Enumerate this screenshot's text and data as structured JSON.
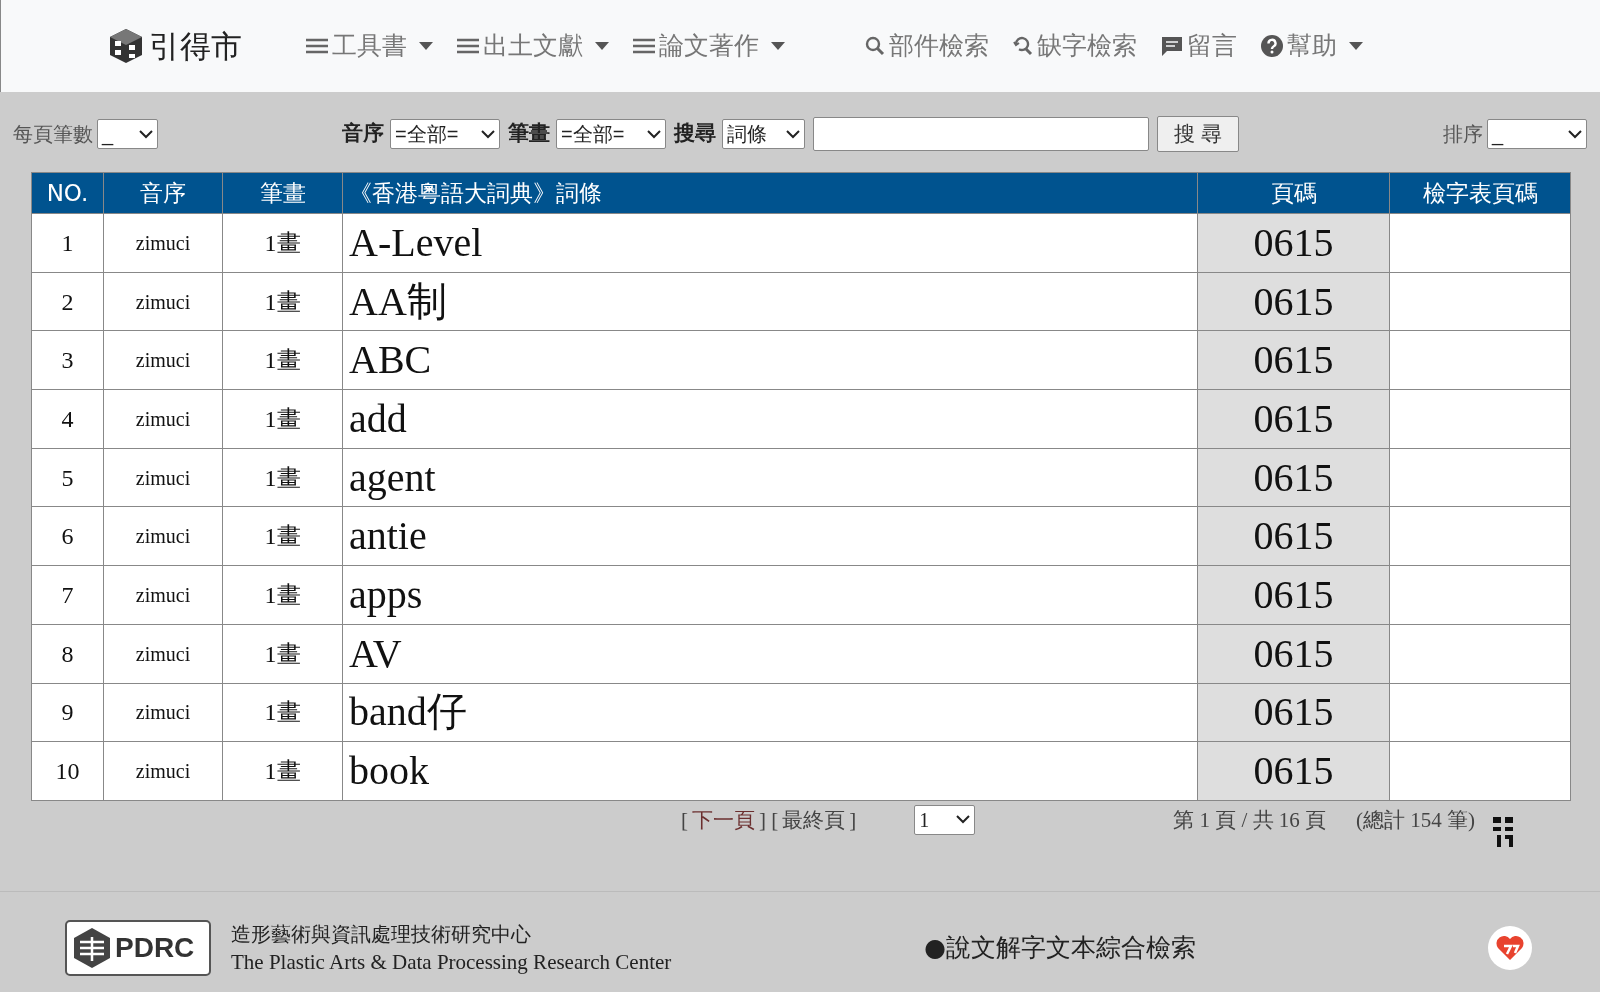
{
  "brand": {
    "title": "引得市"
  },
  "nav": [
    {
      "kind": "menu",
      "label": "工具書",
      "dropdown": true
    },
    {
      "kind": "menu",
      "label": "出土文獻",
      "dropdown": true
    },
    {
      "kind": "menu",
      "label": "論文著作",
      "dropdown": true
    },
    {
      "kind": "search",
      "label": "部件檢索",
      "dropdown": false
    },
    {
      "kind": "lookup",
      "label": "缺字檢索",
      "dropdown": false
    },
    {
      "kind": "message",
      "label": "留言",
      "dropdown": false
    },
    {
      "kind": "help",
      "label": "幫助",
      "dropdown": true
    }
  ],
  "toolbar": {
    "per_page": {
      "label": "每頁筆數",
      "value": "_"
    },
    "filters": [
      {
        "label": "音序",
        "value": "=全部="
      },
      {
        "label": "筆畫",
        "value": "=全部="
      },
      {
        "label": "搜尋",
        "value": "詞條"
      }
    ],
    "search_button": "搜 尋",
    "sort": {
      "label": "排序",
      "value": "_"
    }
  },
  "table": {
    "columns": [
      "NO.",
      "音序",
      "筆畫",
      "《香港粵語大詞典》詞條",
      "頁碼",
      "檢字表頁碼"
    ],
    "rows": [
      [
        "1",
        "zimuci",
        "1畫",
        "A-Level",
        "0615"
      ],
      [
        "2",
        "zimuci",
        "1畫",
        "AA制",
        "0615"
      ],
      [
        "3",
        "zimuci",
        "1畫",
        "ABC",
        "0615"
      ],
      [
        "4",
        "zimuci",
        "1畫",
        "add",
        "0615"
      ],
      [
        "5",
        "zimuci",
        "1畫",
        "agent",
        "0615"
      ],
      [
        "6",
        "zimuci",
        "1畫",
        "antie",
        "0615"
      ],
      [
        "7",
        "zimuci",
        "1畫",
        "apps",
        "0615"
      ],
      [
        "8",
        "zimuci",
        "1畫",
        "AV",
        "0615"
      ],
      [
        "9",
        "zimuci",
        "1畫",
        "band仔",
        "0615"
      ],
      [
        "10",
        "zimuci",
        "1畫",
        "book",
        "0615"
      ]
    ]
  },
  "pagination": {
    "open": "[",
    "next": "下一頁",
    "mid": "] [",
    "last": "最終頁",
    "close": "]",
    "page_select": "1",
    "page_info": "第 1 頁 / 共 16 頁",
    "total": "(總計 154 筆)"
  },
  "footer": {
    "logo": "PDRC",
    "name_zh": "造形藝術與資訊處理技術研究中心",
    "name_en": "The Plastic Arts & Data Processing Research Center",
    "link": "●說文解字文本綜合檢索"
  }
}
